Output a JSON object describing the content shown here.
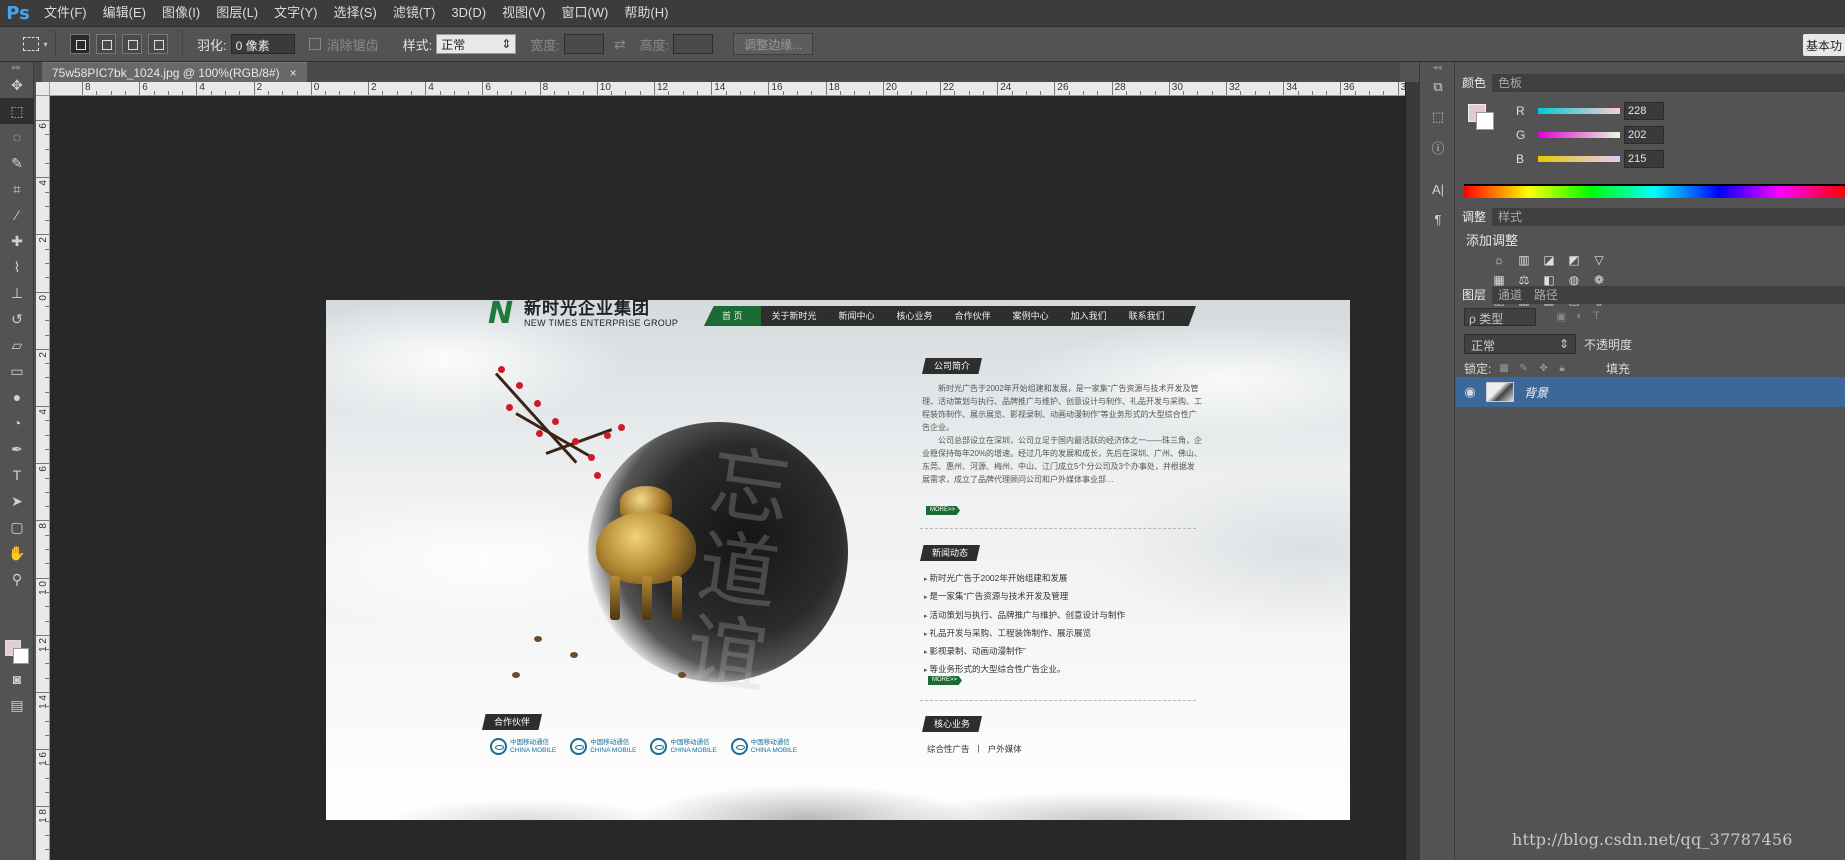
{
  "app": {
    "logo": "Ps"
  },
  "menu": [
    "文件(F)",
    "编辑(E)",
    "图像(I)",
    "图层(L)",
    "文字(Y)",
    "选择(S)",
    "滤镜(T)",
    "3D(D)",
    "视图(V)",
    "窗口(W)",
    "帮助(H)"
  ],
  "workspace": "基本功",
  "options": {
    "feather_label": "羽化:",
    "feather_value": "0 像素",
    "antialias_label": "消除锯齿",
    "style_label": "样式:",
    "style_value": "正常",
    "width_label": "宽度:",
    "height_label": "高度:",
    "refine_button": "调整边缘..."
  },
  "document": {
    "tab_title": "75w58PIC7bk_1024.jpg @ 100%(RGB/8#)",
    "close": "×"
  },
  "ruler_h_labels": [
    "8",
    "6",
    "4",
    "2",
    "0",
    "2",
    "4",
    "6",
    "8",
    "10",
    "12",
    "14",
    "16",
    "18",
    "20",
    "22",
    "24",
    "26",
    "28",
    "30",
    "32",
    "34",
    "36",
    "38",
    "40",
    "42",
    "44"
  ],
  "ruler_v_labels": [
    "6",
    "4",
    "2",
    "0",
    "2",
    "4",
    "6",
    "8",
    "1 0",
    "1 2",
    "1 4",
    "1 6",
    "1 8"
  ],
  "webpage": {
    "logo_mark": "N",
    "logo_cn": "新时光企业集团",
    "logo_en": "NEW TIMES ENTERPRISE GROUP",
    "nav": [
      "首 页",
      "关于新时光",
      "新闻中心",
      "核心业务",
      "合作伙伴",
      "案例中心",
      "加入我们",
      "联系我们"
    ],
    "calligraphy": "忘道谊",
    "about_head": "公司简介",
    "about_p1": "新时光广告于2002年开始组建和发展，是一家集“广告资源与技术开发及管理、活动策划与执行、品牌推广与维护、创意设计与制作、礼品开发与采购、工程装饰制作、展示展览、影视录制、动画动漫制作”等业务形式的大型综合性广告企业。",
    "about_p2": "公司总部设立在深圳，公司立足于国内最活跃的经济体之一——珠三角，企业稳保持每年20%的增速。经过几年的发展和成长，先后在深圳、广州、佛山、东莞、惠州、河源、梅州、中山、江门成立5个分公司及3个办事处，并根据发展需求，成立了品牌代理顾问公司和户外媒体事业部…",
    "more": "MORE>>",
    "news_head": "新闻动态",
    "news": [
      "新时光广告于2002年开始组建和发展",
      "是一家集“广告资源与技术开发及管理",
      "活动策划与执行、品牌推广与维护、创意设计与制作",
      "礼品开发与采购、工程装饰制作、展示展览",
      "影视录制、动画动漫制作”",
      "等业务形式的大型综合性广告企业。"
    ],
    "partner_head": "合作伙伴",
    "partner_cn": "中国移动通信",
    "partner_en": "CHINA MOBILE",
    "core_head": "核心业务",
    "core_items": [
      "综合性广告",
      "|",
      "户外媒体"
    ]
  },
  "color_panel": {
    "tabs": [
      "颜色",
      "色板"
    ],
    "channels": [
      {
        "name": "R",
        "value": "228",
        "level": 0.894
      },
      {
        "name": "G",
        "value": "202",
        "level": 0.792
      },
      {
        "name": "B",
        "value": "215",
        "level": 0.843
      }
    ],
    "fg_color": "#e4cad7"
  },
  "adjust_panel": {
    "tabs": [
      "调整",
      "样式"
    ],
    "title": "添加调整"
  },
  "layers_panel": {
    "tabs": [
      "图层",
      "通道",
      "路径"
    ],
    "filter": "ρ 类型",
    "blend_mode": "正常",
    "opacity_label": "不透明度",
    "lock_label": "锁定:",
    "fill_label": "填充",
    "layer_name": "背景"
  },
  "watermark": "http://blog.csdn.net/qq_37787456"
}
